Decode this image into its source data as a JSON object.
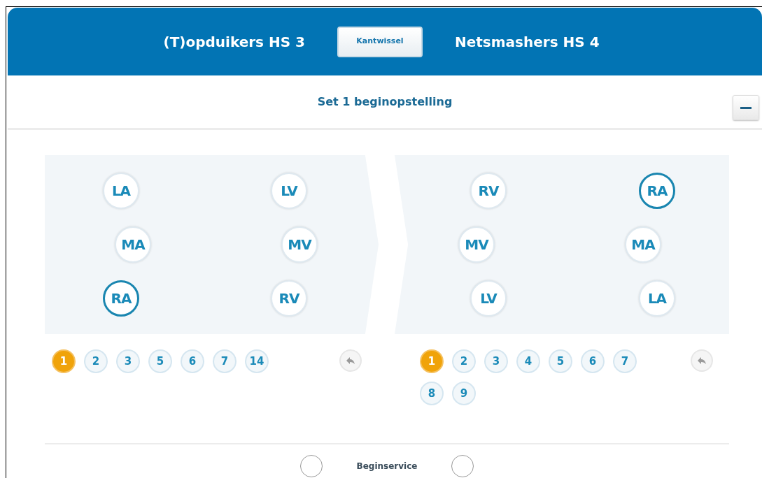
{
  "header": {
    "teams": [
      "(T)opduikers HS 3",
      "Netsmashers HS 4"
    ],
    "swap_button": "Kantwissel"
  },
  "section": {
    "title": "Set 1 beginopstelling",
    "expanded": true
  },
  "courts": [
    {
      "rows": [
        [
          {
            "label": "LA",
            "selected": false
          },
          {
            "label": "LV",
            "selected": false
          }
        ],
        [
          {
            "label": "MA",
            "selected": false
          },
          {
            "label": "MV",
            "selected": false
          }
        ],
        [
          {
            "label": "RA",
            "selected": true
          },
          {
            "label": "RV",
            "selected": false
          }
        ]
      ],
      "players": [
        {
          "number": "1",
          "selected": true
        },
        {
          "number": "2",
          "selected": false
        },
        {
          "number": "3",
          "selected": false
        },
        {
          "number": "5",
          "selected": false
        },
        {
          "number": "6",
          "selected": false
        },
        {
          "number": "7",
          "selected": false
        },
        {
          "number": "14",
          "selected": false
        }
      ]
    },
    {
      "rows": [
        [
          {
            "label": "RV",
            "selected": false
          },
          {
            "label": "RA",
            "selected": true
          }
        ],
        [
          {
            "label": "MV",
            "selected": false
          },
          {
            "label": "MA",
            "selected": false
          }
        ],
        [
          {
            "label": "LV",
            "selected": false
          },
          {
            "label": "LA",
            "selected": false
          }
        ]
      ],
      "players": [
        {
          "number": "1",
          "selected": true
        },
        {
          "number": "2",
          "selected": false
        },
        {
          "number": "3",
          "selected": false
        },
        {
          "number": "4",
          "selected": false
        },
        {
          "number": "5",
          "selected": false
        },
        {
          "number": "6",
          "selected": false
        },
        {
          "number": "7",
          "selected": false
        },
        {
          "number": "8",
          "selected": false
        },
        {
          "number": "9",
          "selected": false
        }
      ]
    }
  ],
  "service": {
    "label": "Beginservice",
    "options": [
      {
        "selected": false
      },
      {
        "selected": false
      }
    ]
  }
}
